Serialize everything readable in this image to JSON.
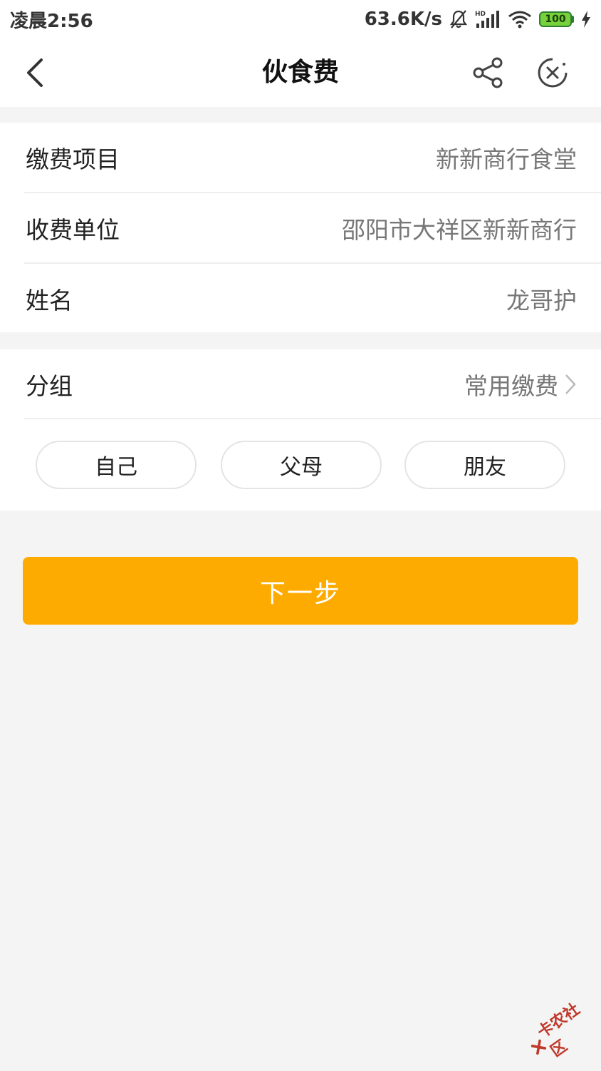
{
  "status_bar": {
    "time": "凌晨2:56",
    "network_speed": "63.6K/s",
    "battery_level": "100",
    "icons": [
      "bell-muted-icon",
      "hd-signal-icon",
      "wifi-icon",
      "battery-icon",
      "charging-icon"
    ]
  },
  "nav": {
    "title": "伙食费",
    "icons": [
      "back-arrow-icon",
      "share-icon",
      "close-circle-icon"
    ]
  },
  "info_rows": [
    {
      "label": "缴费项目",
      "value": "新新商行食堂"
    },
    {
      "label": "收费单位",
      "value": "邵阳市大祥区新新商行"
    },
    {
      "label": "姓名",
      "value": "龙哥护"
    }
  ],
  "group": {
    "label": "分组",
    "value": "常用缴费",
    "chips": [
      "自己",
      "父母",
      "朋友"
    ]
  },
  "next_button": {
    "label": "下一步"
  },
  "watermark": {
    "text": "卡农社区"
  },
  "colors": {
    "accent": "#fdab00",
    "background": "#f4f4f4",
    "card": "#ffffff",
    "value_text": "#777777"
  }
}
